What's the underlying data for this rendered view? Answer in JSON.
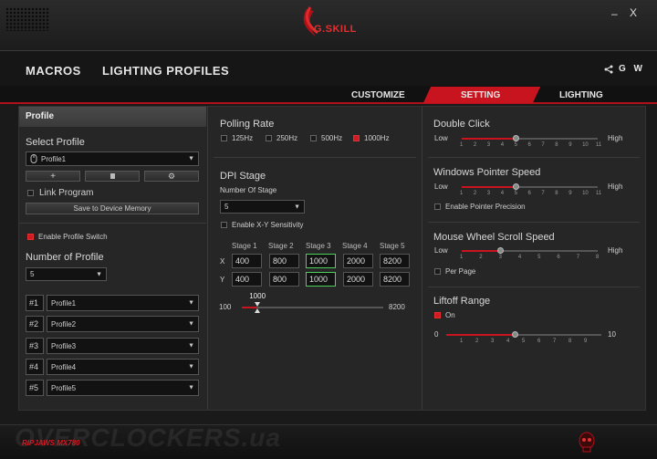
{
  "window": {
    "minimize": "–",
    "close": "X"
  },
  "brand": {
    "logo_text": "G.SKILL"
  },
  "nav": {
    "macros": "MACROS",
    "lighting_profiles": "LIGHTING PROFILES",
    "extras": "G W"
  },
  "subtabs": {
    "customize": "CUSTOMIZE",
    "setting": "SETTING",
    "lighting": "LIGHTING"
  },
  "profile": {
    "title": "Profile",
    "select_label": "Select Profile",
    "selected": "Profile1",
    "link_program": "Link Program",
    "save_button": "Save to Device Memory",
    "enable_switch": "Enable Profile Switch",
    "number_label": "Number of Profile",
    "number_value": "5",
    "slots": [
      {
        "id": "#1",
        "name": "Profile1"
      },
      {
        "id": "#2",
        "name": "Profile2"
      },
      {
        "id": "#3",
        "name": "Profile3"
      },
      {
        "id": "#4",
        "name": "Profile4"
      },
      {
        "id": "#5",
        "name": "Profile5"
      }
    ]
  },
  "polling": {
    "title": "Polling Rate",
    "options": [
      {
        "label": "125Hz",
        "on": false
      },
      {
        "label": "250Hz",
        "on": false
      },
      {
        "label": "500Hz",
        "on": false
      },
      {
        "label": "1000Hz",
        "on": true
      }
    ]
  },
  "dpi": {
    "title": "DPI Stage",
    "num_label": "Number Of Stage",
    "num_value": "5",
    "xy_label": "Enable X-Y Sensitivity",
    "stages": [
      "Stage 1",
      "Stage 2",
      "Stage 3",
      "Stage 4",
      "Stage 5"
    ],
    "x_label": "X",
    "y_label": "Y",
    "x_values": [
      "400",
      "800",
      "1000",
      "2000",
      "8200"
    ],
    "y_values": [
      "400",
      "800",
      "1000",
      "2000",
      "8200"
    ],
    "selected_stage": 3,
    "slider": {
      "min": "100",
      "max": "8200",
      "value": "1000",
      "value_num": 1000,
      "min_num": 100,
      "max_num": 8200
    }
  },
  "double_click": {
    "title": "Double Click",
    "low": "Low",
    "high": "High",
    "ticks": [
      "1",
      "2",
      "3",
      "4",
      "5",
      "6",
      "7",
      "8",
      "9",
      "10",
      "11"
    ],
    "value": 5
  },
  "pointer_speed": {
    "title": "Windows Pointer Speed",
    "low": "Low",
    "high": "High",
    "ticks": [
      "1",
      "2",
      "3",
      "4",
      "5",
      "6",
      "7",
      "8",
      "9",
      "10",
      "11"
    ],
    "value": 5,
    "precision": "Enable Pointer Precision"
  },
  "scroll": {
    "title": "Mouse Wheel Scroll Speed",
    "low": "Low",
    "high": "High",
    "ticks": [
      "1",
      "2",
      "3",
      "4",
      "5",
      "6",
      "7",
      "8"
    ],
    "value": 3,
    "per_page": "Per Page"
  },
  "liftoff": {
    "title": "Liftoff Range",
    "on_label": "On",
    "min": "0",
    "max": "10",
    "ticks": [
      "1",
      "2",
      "3",
      "4",
      "5",
      "6",
      "7",
      "8",
      "9"
    ],
    "value": 4
  },
  "footer": {
    "model": "RIPJAWS MX780",
    "watermark": "OVERCLOCKERS.ua"
  },
  "colors": {
    "accent": "#c8141e",
    "selected_box": "#4ed05a"
  }
}
